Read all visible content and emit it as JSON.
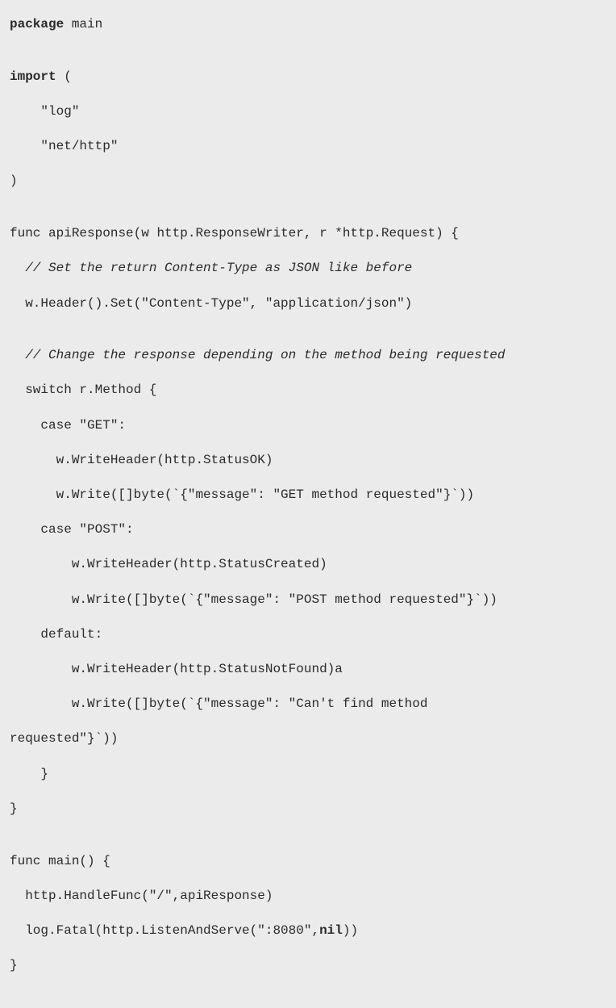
{
  "code": {
    "l1_kw": "package",
    "l1_rest": " main",
    "l2": "",
    "l3_kw": "import",
    "l3_rest": " (",
    "l4": "    \"log\"",
    "l5": "    \"net/http\"",
    "l6": ")",
    "l7": "",
    "l8_a": "func ",
    "l8_b": "a",
    "l8_c": "piResponse(w http.ResponseWriter, r *http.Request) {",
    "l9": "  // Set the return Content-Type as JSON like before",
    "l10": "  w.Header().Set(\"Content-Type\", \"application/json\")",
    "l11": "",
    "l12": "  // Change the response depending on the method being requested",
    "l13": "  switch r.Method {",
    "l14": "    case \"GET\":",
    "l15": "      w.WriteHeader(http.StatusOK)",
    "l16": "      w.Write([]byte(`{\"message\": \"GET method requested\"}`))",
    "l17": "    case \"POST\":",
    "l18": "        w.WriteHeader(http.StatusCreated)",
    "l19": "        w.Write([]byte(`{\"message\": \"POST method requested\"}`))",
    "l20": "    default:",
    "l21": "        w.WriteHeader(http.StatusNotFound)a",
    "l22a": "        w.Write([]byte(`{\"message\": \"Can't find method",
    "l22b": "requested\"}`))",
    "l23": "    }",
    "l24": "}",
    "l25": "",
    "l26": "func main() {",
    "l27": "  http.HandleFunc(\"/\",apiResponse)",
    "l28_a": "  log.Fatal(http.ListenAndServe(\":8080\",",
    "l28_b": "nil",
    "l28_c": "))",
    "l29": "}"
  }
}
